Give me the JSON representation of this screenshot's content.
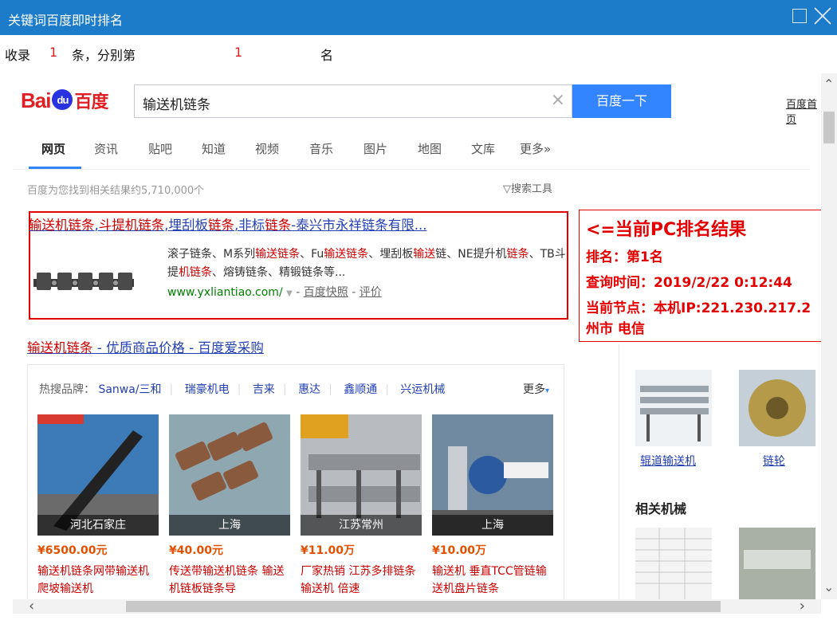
{
  "window": {
    "title": "关键词百度即时排名"
  },
  "status": {
    "prefix": "收录",
    "count": "1",
    "middle": "条，分别第",
    "rank": "1",
    "suffix": "名"
  },
  "baidu": {
    "logo_text_left": "Bai",
    "logo_paw": "du",
    "logo_text_right": "百度",
    "query": "输送机链条",
    "clear_glyph": "×",
    "search_button": "百度一下",
    "home_link": "百度首页"
  },
  "tabs": [
    "网页",
    "资讯",
    "贴吧",
    "知道",
    "视频",
    "音乐",
    "图片",
    "地图",
    "文库",
    "更多»"
  ],
  "result_count": "百度为您找到相关结果约5,710,000个",
  "search_tools": "▽搜索工具",
  "result1": {
    "title_parts": [
      {
        "text": "输送机链条",
        "hl": true
      },
      {
        "text": ",",
        "hl": false
      },
      {
        "text": "斗提机链条",
        "hl": true
      },
      {
        "text": ",埋刮板",
        "hl": false
      },
      {
        "text": "链条",
        "hl": true
      },
      {
        "text": ",非标",
        "hl": false
      },
      {
        "text": "链条",
        "hl": true
      },
      {
        "text": "-泰兴市永祥链条有限...",
        "hl": false
      }
    ],
    "snippet_parts": [
      {
        "text": "滚子链条、M系列",
        "hl": false
      },
      {
        "text": "输送链条",
        "hl": true
      },
      {
        "text": "、Fu",
        "hl": false
      },
      {
        "text": "输送链条",
        "hl": true
      },
      {
        "text": "、埋刮板",
        "hl": false
      },
      {
        "text": "输送",
        "hl": true
      },
      {
        "text": "链、NE提升机",
        "hl": false
      },
      {
        "text": "链条",
        "hl": true
      },
      {
        "text": "、TB斗提",
        "hl": false
      },
      {
        "text": "机链条",
        "hl": true
      },
      {
        "text": "、熔铸链条、精锻链条等...",
        "hl": false
      }
    ],
    "url": "www.yxliantiao.com/",
    "url_arrow": "▼",
    "dash": "-",
    "cache_link": "百度快照",
    "review_sep": "-",
    "review_link": "评价"
  },
  "rank_panel": {
    "headline": "<=当前PC排名结果",
    "rank_line": "排名：第1名",
    "time_line": "查询时间：2019/2/22 0:12:44",
    "node_line": "当前节点：本机IP:221.230.217.2",
    "node_line2": "州市 电信"
  },
  "result2": {
    "title_parts": [
      {
        "text": "输送机链条",
        "hl": true
      },
      {
        "text": " - 优质商品价格 - 百度爱采购",
        "hl": false
      }
    ]
  },
  "shop": {
    "hot_label": "热搜品牌：",
    "brands": [
      "Sanwa/三和",
      "瑞豪机电",
      "吉来",
      "惠达",
      "鑫顺通",
      "兴运机械"
    ],
    "more": "更多",
    "more_arrow": "▾",
    "products": [
      {
        "location": "河北石家庄",
        "price": "¥6500.00元",
        "name": "输送机链条网带输送机爬坡输送机"
      },
      {
        "location": "上海",
        "price": "¥40.00元",
        "name": "传送带输送机链条 输送机链板链条导"
      },
      {
        "location": "江苏常州",
        "price": "¥11.00万",
        "name": "厂家热销 江苏多排链条输送机 倍速"
      },
      {
        "location": "上海",
        "price": "¥10.00万",
        "name": "输送机 垂直TCC管链输送机盘片链条"
      }
    ]
  },
  "related": {
    "items": [
      "辊道输送机",
      "链轮"
    ],
    "heading": "相关机械"
  },
  "scrollbars": {
    "up": "⌃",
    "down": "⌄",
    "left": "‹",
    "right": "›"
  }
}
